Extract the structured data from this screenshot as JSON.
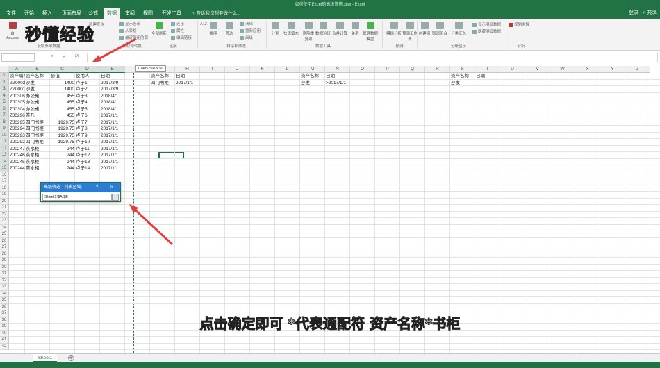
{
  "window": {
    "title": "如何使用Excel的高级筛选.xlsx - Excel"
  },
  "ribbon_tabs": [
    {
      "label": "文件"
    },
    {
      "label": "开始"
    },
    {
      "label": "插入"
    },
    {
      "label": "页面布局"
    },
    {
      "label": "公式"
    },
    {
      "label": "数据"
    },
    {
      "label": "审阅"
    },
    {
      "label": "视图"
    },
    {
      "label": "开发工具"
    }
  ],
  "tell_me": "♀ 告诉我您想要做什么...",
  "account": {
    "login": "登录",
    "share": "♀ 共享"
  },
  "ribbon": {
    "get_external_data": {
      "access": "自 Access",
      "group": "获取外部数据"
    },
    "get_transform": {
      "new_query": "新建查询",
      "show_queries": "显示查询",
      "from_table": "从表格",
      "recent_sources": "最近使用的源",
      "group": "获取和转换"
    },
    "connections": {
      "refresh_all": "全部刷新",
      "connections": "连接",
      "properties": "属性",
      "edit_links": "编辑链接",
      "group": "连接"
    },
    "sort_filter": {
      "sort_az": "A↓Z",
      "sort": "排序",
      "filter": "筛选",
      "clear": "清除",
      "reapply": "重新应用",
      "advanced": "高级",
      "group": "排序和筛选"
    },
    "data_tools": {
      "text_to_columns": "分列",
      "flash_fill": "快速填充",
      "remove_duplicates": "删除重复项",
      "validation": "数据验证",
      "consolidate": "合并计算",
      "relationships": "关系",
      "manage_model": "管理数据模型",
      "group": "数据工具"
    },
    "forecast": {
      "what_if": "模拟分析",
      "forecast_sheet": "预测工作表",
      "group": "预测"
    },
    "outline": {
      "group_btn": "创建组",
      "ungroup": "取消组合",
      "subtotal": "分类汇总",
      "show_detail": "显示明细数据",
      "hide_detail": "隐藏明细数据",
      "group": "分级显示"
    },
    "analysis": {
      "solver": "规划求解",
      "group": "分析"
    }
  },
  "formula_bar": {
    "name_box": "",
    "fx": "fx"
  },
  "columns": [
    "A",
    "B",
    "C",
    "D",
    "E",
    "F",
    "G",
    "H",
    "I",
    "J",
    "K",
    "L",
    "M",
    "N",
    "O",
    "P",
    "Q",
    "R",
    "S",
    "T",
    "U",
    "V",
    "W",
    "X",
    "Y",
    "Z"
  ],
  "rows": [
    "1",
    "2",
    "3",
    "4",
    "5",
    "6",
    "7",
    "8",
    "9",
    "10",
    "11",
    "12",
    "13",
    "14",
    "15",
    "16",
    "17",
    "18",
    "19",
    "20",
    "21",
    "22",
    "23",
    "24",
    "25",
    "26",
    "27",
    "28",
    "29",
    "30",
    "31",
    "32",
    "33",
    "34",
    "35",
    "36",
    "37",
    "38",
    "39",
    "40",
    "41",
    "42"
  ],
  "table": {
    "headers": [
      "资产编号",
      "资产名称",
      "价值",
      "使用人",
      "日期"
    ],
    "rows": [
      [
        "ZZ0002",
        "沙发",
        "1400",
        "卢子1",
        "2017/3/9"
      ],
      [
        "ZZ0001",
        "沙发",
        "1400",
        "卢子2",
        "2017/3/9"
      ],
      [
        "ZJ0306",
        "办公桌",
        "455",
        "卢子3",
        "2018/4/1"
      ],
      [
        "ZJ0305",
        "办公桌",
        "455",
        "卢子4",
        "2018/4/1"
      ],
      [
        "ZJ0304",
        "办公桌",
        "455",
        "卢子5",
        "2018/4/1"
      ],
      [
        "ZJ0296",
        "茶几",
        "455",
        "卢子6",
        "2017/1/1"
      ],
      [
        "ZJ0295",
        "四门书柜",
        "1929.75",
        "卢子7",
        "2017/1/1"
      ],
      [
        "ZJ0294",
        "四门书柜",
        "1929.75",
        "卢子8",
        "2017/1/1"
      ],
      [
        "ZJ0293",
        "四门书柜",
        "1929.75",
        "卢子9",
        "2017/1/1"
      ],
      [
        "ZJ0292",
        "四门书柜",
        "1929.75",
        "卢子10",
        "2017/1/1"
      ],
      [
        "ZJ0247",
        "茶水柜",
        "244",
        "卢子11",
        "2017/1/1"
      ],
      [
        "ZJ0246",
        "茶水柜",
        "244",
        "卢子12",
        "2017/1/1"
      ],
      [
        "ZJ0245",
        "茶水柜",
        "244",
        "卢子13",
        "2017/1/1"
      ],
      [
        "ZJ0244",
        "茶水柜",
        "244",
        "卢子14",
        "2017/1/1"
      ]
    ]
  },
  "criteria1": {
    "h1": "资产名称",
    "h2": "日期",
    "v1": "四门书柜",
    "v2": "2017/1/1"
  },
  "criteria2": {
    "h1": "资产名称",
    "h2": "日期",
    "v1": "沙发",
    "v2": ">2017/1/1"
  },
  "criteria3": {
    "h1": "资产名称",
    "h2": "日期",
    "v1": "沙发"
  },
  "size_tooltip": "1048576R x 5C",
  "dialog": {
    "title": "高级筛选 - 列表区域:",
    "help": "?",
    "close": "×",
    "range_value": "Sheet1!$A:$E"
  },
  "sheets": [
    {
      "label": "Sheet1"
    }
  ],
  "add_sheet": "⊕",
  "watermark": "秒懂经验",
  "caption": "点击确定即可 *代表通配符 资产名称*书柜",
  "colors": {
    "excel_green": "#217346",
    "dialog_blue": "#2b7cd3",
    "arrow": "#e04040"
  }
}
